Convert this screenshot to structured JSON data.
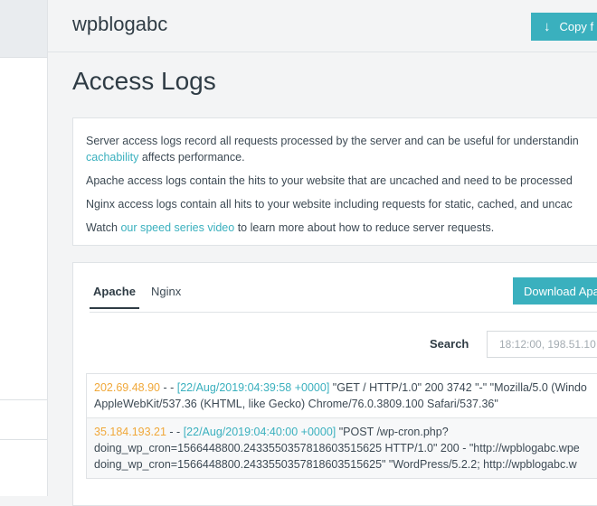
{
  "site": {
    "name": "wpblogabc",
    "copy_button": "Copy f"
  },
  "page": {
    "title": "Access Logs"
  },
  "info": {
    "p1_text": "Server access logs record all requests processed by the server and can be useful for understandin",
    "p1_link": "cachability",
    "p1_tail": " affects performance.",
    "p2": "Apache access logs contain the hits to your website that are uncached and need to be processed",
    "p3": "Nginx access logs contain all hits to your website including requests for static, cached, and uncac",
    "p4_pre": "Watch ",
    "p4_link": "our speed series video",
    "p4_post": " to learn more about how to reduce server requests."
  },
  "logs": {
    "tabs": [
      {
        "label": "Apache"
      },
      {
        "label": "Nginx"
      }
    ],
    "download_button": "Download Apa",
    "search_label": "Search",
    "search_placeholder": "18:12:00, 198.51.10",
    "entries": [
      {
        "ip": "202.69.48.90",
        "sep": " - - ",
        "timestamp": "[22/Aug/2019:04:39:58 +0000]",
        "line1": " \"GET / HTTP/1.0\" 200 3742 \"-\" \"Mozilla/5.0 (Windo",
        "line2": "AppleWebKit/537.36 (KHTML, like Gecko) Chrome/76.0.3809.100 Safari/537.36\""
      },
      {
        "ip": "35.184.193.21",
        "sep": " - - ",
        "timestamp": "[22/Aug/2019:04:40:00 +0000]",
        "line1": " \"POST /wp-cron.php?",
        "line2": "doing_wp_cron=1566448800.2433550357818603515625 HTTP/1.0\" 200 - \"http://wpblogabc.wpe",
        "line3": "doing_wp_cron=1566448800.2433550357818603515625\" \"WordPress/5.2.2; http://wpblogabc.w"
      }
    ]
  },
  "colors": {
    "accent": "#3ab0be",
    "ip": "#f0a83a",
    "text": "#3d4a54"
  }
}
